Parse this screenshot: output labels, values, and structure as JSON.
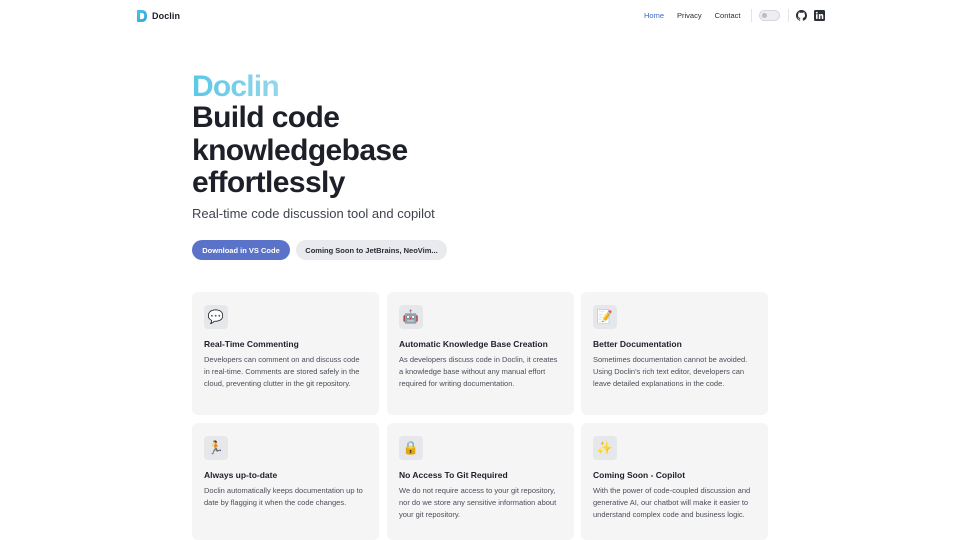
{
  "nav": {
    "brand": "Doclin",
    "links": [
      {
        "label": "Home",
        "active": true
      },
      {
        "label": "Privacy",
        "active": false
      },
      {
        "label": "Contact",
        "active": false
      }
    ],
    "icons": [
      "theme-toggle",
      "github-icon",
      "linkedin-icon"
    ]
  },
  "hero": {
    "brand": "Doclin",
    "title_lines": [
      "Build code",
      "knowledgebase",
      "effortlessly"
    ],
    "subtitle": "Real-time code discussion tool and copilot",
    "primary_button": "Download in VS Code",
    "secondary_button": "Coming Soon to JetBrains, NeoVim..."
  },
  "features": [
    {
      "icon": "💬",
      "title": "Real-Time Commenting",
      "desc": "Developers can comment on and discuss code in real-time. Comments are stored safely in the cloud, preventing clutter in the git repository."
    },
    {
      "icon": "🤖",
      "title": "Automatic Knowledge Base Creation",
      "desc": "As developers discuss code in Doclin, it creates a knowledge base without any manual effort required for writing documentation."
    },
    {
      "icon": "📝",
      "title": "Better Documentation",
      "desc": "Sometimes documentation cannot be avoided. Using Doclin's rich text editor, developers can leave detailed explanations in the code."
    },
    {
      "icon": "🏃",
      "title": "Always up-to-date",
      "desc": "Doclin automatically keeps documentation up to date by flagging it when the code changes."
    },
    {
      "icon": "🔒",
      "title": "No Access To Git Required",
      "desc": "We do not require access to your git repository, nor do we store any sensitive information about your git repository."
    },
    {
      "icon": "✨",
      "title": "Coming Soon - Copilot",
      "desc": "With the power of code-coupled discussion and generative AI, our chatbot will make it easier to understand complex code and business logic."
    }
  ],
  "colors": {
    "accent": "#5a73c9",
    "brand_gradient_start": "#5bc7e8",
    "active_link": "#3a66c4"
  }
}
